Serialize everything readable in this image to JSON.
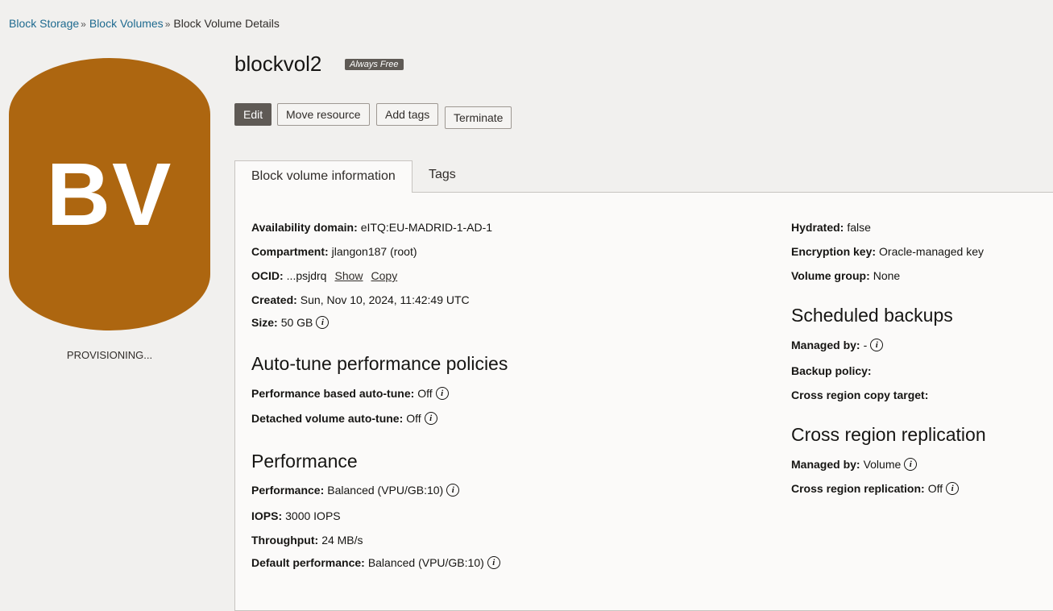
{
  "breadcrumb": {
    "item1": "Block Storage",
    "sep": "»",
    "item2": "Block Volumes",
    "current": "Block Volume Details"
  },
  "avatar": {
    "initials": "BV",
    "state": "PROVISIONING...",
    "color": "#ad6610"
  },
  "header": {
    "title": "blockvol2",
    "badge": "Always Free"
  },
  "actions": {
    "edit": "Edit",
    "move": "Move resource",
    "tags": "Add tags",
    "terminate": "Terminate"
  },
  "tabs": {
    "info": "Block volume information",
    "tags": "Tags"
  },
  "left": {
    "availability": {
      "label": "Availability domain:",
      "value": "eITQ:EU-MADRID-1-AD-1"
    },
    "compartment": {
      "label": "Compartment:",
      "value": "jlangon187 (root)"
    },
    "ocid": {
      "label": "OCID:",
      "value": "...psjdrq",
      "show": "Show",
      "copy": "Copy"
    },
    "created": {
      "label": "Created:",
      "value": "Sun, Nov 10, 2024, 11:42:49 UTC"
    },
    "size": {
      "label": "Size:",
      "value": "50 GB"
    },
    "autotune_heading": "Auto-tune performance policies",
    "perf_autotune": {
      "label": "Performance based auto-tune:",
      "value": "Off"
    },
    "detached_autotune": {
      "label": "Detached volume auto-tune:",
      "value": "Off"
    },
    "performance_heading": "Performance",
    "performance": {
      "label": "Performance:",
      "value": "Balanced (VPU/GB:10)"
    },
    "iops": {
      "label": "IOPS:",
      "value": "3000 IOPS"
    },
    "throughput": {
      "label": "Throughput:",
      "value": "24 MB/s"
    },
    "default_perf": {
      "label": "Default performance:",
      "value": "Balanced (VPU/GB:10)"
    }
  },
  "right": {
    "hydrated": {
      "label": "Hydrated:",
      "value": "false"
    },
    "encryption": {
      "label": "Encryption key:",
      "value": "Oracle-managed key"
    },
    "volume_group": {
      "label": "Volume group:",
      "value": "None"
    },
    "backups_heading": "Scheduled backups",
    "backups_managed": {
      "label": "Managed by:",
      "value": "-"
    },
    "backup_policy": {
      "label": "Backup policy:",
      "value": ""
    },
    "copy_target": {
      "label": "Cross region copy target:",
      "value": ""
    },
    "replication_heading": "Cross region replication",
    "repl_managed": {
      "label": "Managed by:",
      "value": "Volume"
    },
    "replication": {
      "label": "Cross region replication:",
      "value": "Off"
    }
  },
  "info_glyph": "i"
}
